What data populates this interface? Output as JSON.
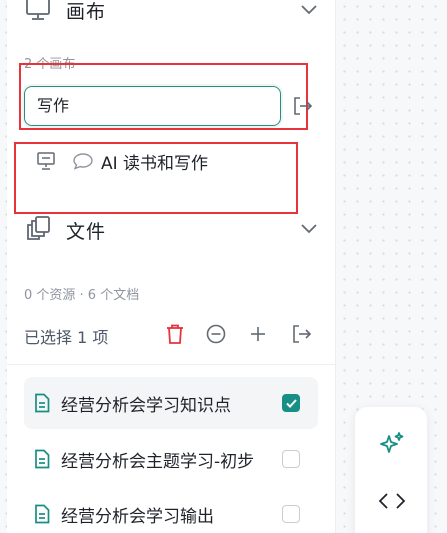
{
  "canvas_section": {
    "title": "画布",
    "count_text": "2 个画布",
    "input_value": "写作",
    "items": [
      {
        "label": "AI 读书和写作"
      }
    ]
  },
  "files_section": {
    "title": "文件",
    "summary": "0 个资源 · 6 个文档",
    "selection_text": "已选择 1 项",
    "docs": [
      {
        "name": "经营分析会学习知识点",
        "checked": true
      },
      {
        "name": "经营分析会主题学习-初步",
        "checked": false
      },
      {
        "name": "经营分析会学习输出",
        "checked": false
      }
    ]
  },
  "colors": {
    "accent": "#188f84",
    "danger": "#e8333b",
    "highlight_box": "#e8333b"
  },
  "icons": [
    "canvas-section-icon",
    "chevron-down-icon",
    "export-icon",
    "presentation-icon",
    "comment-icon",
    "files-icon",
    "trash-icon",
    "minus-circle-icon",
    "plus-icon",
    "document-icon",
    "sparkle-icon",
    "code-icon"
  ]
}
